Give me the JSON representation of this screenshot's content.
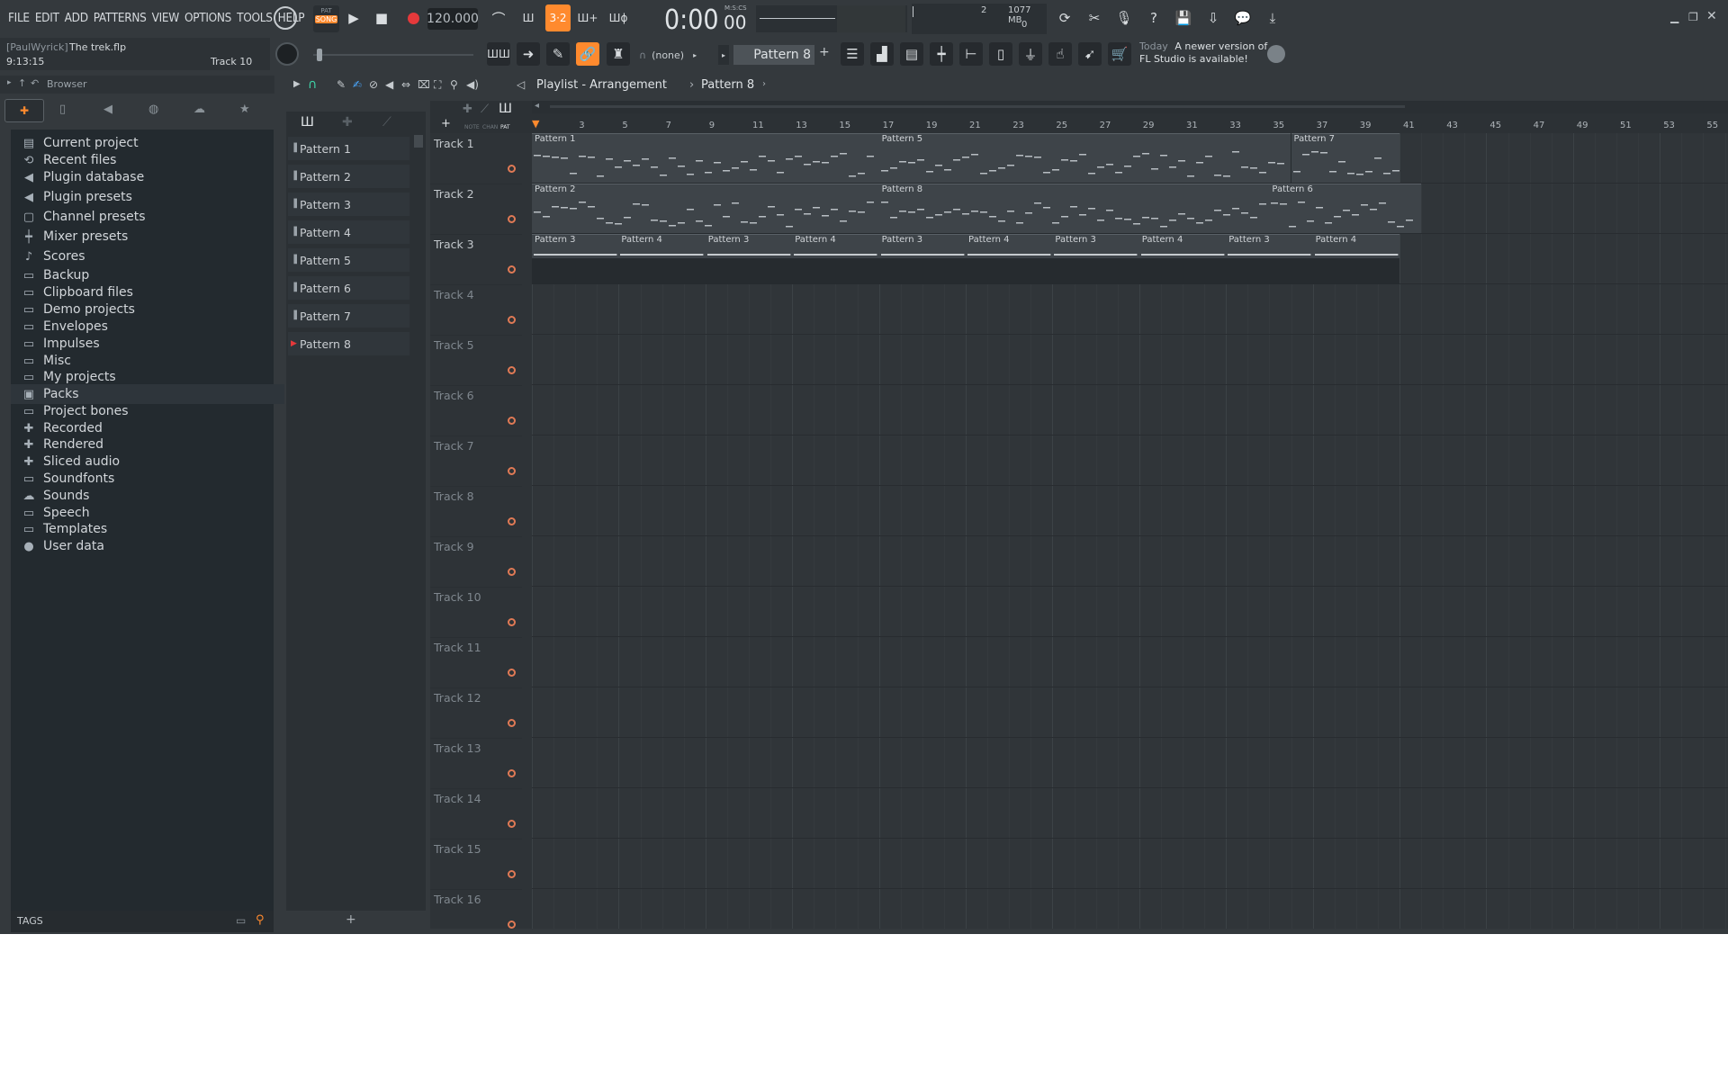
{
  "menu": [
    "FILE",
    "EDIT",
    "ADD",
    "PATTERNS",
    "VIEW",
    "OPTIONS",
    "TOOLS",
    "HELP"
  ],
  "transport": {
    "mode_top": "PAT",
    "mode_bottom": "SONG",
    "tempo": "120.000",
    "time_main": "0:00",
    "time_small": "00",
    "time_unit": "M:S:CS"
  },
  "monitor": {
    "value1": "2",
    "memory": "1077 MB",
    "value2": "0"
  },
  "project": {
    "user": "[PaulWyrick]",
    "file": "The trek.flp",
    "time": "9:13:15",
    "track": "Track 10"
  },
  "browser": {
    "title": "Browser",
    "items": [
      {
        "label": "Current project",
        "icon": "project-icon"
      },
      {
        "label": "Recent files",
        "icon": "recent-icon"
      },
      {
        "label": "Plugin database",
        "icon": "plugin-icon"
      },
      {
        "label": "Plugin presets",
        "icon": "plugin-icon"
      },
      {
        "label": "Channel presets",
        "icon": "channel-icon"
      },
      {
        "label": "Mixer presets",
        "icon": "mixer-icon"
      },
      {
        "label": "Scores",
        "icon": "note-icon"
      },
      {
        "label": "Backup",
        "icon": "folder-icon"
      },
      {
        "label": "Clipboard files",
        "icon": "folder-icon"
      },
      {
        "label": "Demo projects",
        "icon": "folder-icon"
      },
      {
        "label": "Envelopes",
        "icon": "folder-icon"
      },
      {
        "label": "Impulses",
        "icon": "folder-icon"
      },
      {
        "label": "Misc",
        "icon": "folder-icon"
      },
      {
        "label": "My projects",
        "icon": "folder-icon"
      },
      {
        "label": "Packs",
        "icon": "packs-icon"
      },
      {
        "label": "Project bones",
        "icon": "folder-icon"
      },
      {
        "label": "Recorded",
        "icon": "recorded-icon"
      },
      {
        "label": "Rendered",
        "icon": "rendered-icon"
      },
      {
        "label": "Sliced audio",
        "icon": "sliced-icon"
      },
      {
        "label": "Soundfonts",
        "icon": "folder-icon"
      },
      {
        "label": "Sounds",
        "icon": "cloud-icon"
      },
      {
        "label": "Speech",
        "icon": "folder-icon"
      },
      {
        "label": "Templates",
        "icon": "folder-icon"
      },
      {
        "label": "User data",
        "icon": "user-icon"
      }
    ],
    "tags_label": "TAGS"
  },
  "pattern_selector": {
    "value": "Pattern 8",
    "none_label": "(none)"
  },
  "hint": {
    "line1": "Today",
    "line2": "A newer version of",
    "line3": "FL Studio is available!"
  },
  "playlist": {
    "title": "Playlist - Arrangement",
    "crumb": "Pattern 8",
    "picker_tabs": [
      "NOTE",
      "CHAN",
      "PAT"
    ],
    "patterns": [
      "Pattern 1",
      "Pattern 2",
      "Pattern 3",
      "Pattern 4",
      "Pattern 5",
      "Pattern 6",
      "Pattern 7",
      "Pattern 8"
    ],
    "tracks": [
      "Track 1",
      "Track 2",
      "Track 3",
      "Track 4",
      "Track 5",
      "Track 6",
      "Track 7",
      "Track 8",
      "Track 9",
      "Track 10",
      "Track 11",
      "Track 12",
      "Track 13",
      "Track 14",
      "Track 15",
      "Track 16"
    ],
    "bar_labels": [
      "3",
      "5",
      "7",
      "9",
      "11",
      "13",
      "15",
      "17",
      "19",
      "21",
      "23",
      "25",
      "27",
      "29",
      "31",
      "33",
      "35",
      "37",
      "39",
      "41",
      "43",
      "45",
      "47",
      "49",
      "51",
      "53",
      "55"
    ],
    "clips": [
      {
        "track": 0,
        "label": "Pattern 1",
        "start": 1,
        "end": 17
      },
      {
        "track": 0,
        "label": "Pattern 5",
        "start": 17,
        "end": 36
      },
      {
        "track": 0,
        "label": "Pattern 7",
        "start": 36,
        "end": 41
      },
      {
        "track": 1,
        "label": "Pattern 2",
        "start": 1,
        "end": 17
      },
      {
        "track": 1,
        "label": "Pattern 8",
        "start": 17,
        "end": 35
      },
      {
        "track": 1,
        "label": "Pattern 6",
        "start": 35,
        "end": 42
      },
      {
        "track": 2,
        "label": "Pattern 3",
        "start": 1,
        "end": 5
      },
      {
        "track": 2,
        "label": "Pattern 4",
        "start": 5,
        "end": 9
      },
      {
        "track": 2,
        "label": "Pattern 3",
        "start": 9,
        "end": 13
      },
      {
        "track": 2,
        "label": "Pattern 4",
        "start": 13,
        "end": 17
      },
      {
        "track": 2,
        "label": "Pattern 3",
        "start": 17,
        "end": 21
      },
      {
        "track": 2,
        "label": "Pattern 4",
        "start": 21,
        "end": 25
      },
      {
        "track": 2,
        "label": "Pattern 3",
        "start": 25,
        "end": 29
      },
      {
        "track": 2,
        "label": "Pattern 4",
        "start": 29,
        "end": 33
      },
      {
        "track": 2,
        "label": "Pattern 3",
        "start": 33,
        "end": 37
      },
      {
        "track": 2,
        "label": "Pattern 4",
        "start": 37,
        "end": 41
      }
    ]
  },
  "colors": {
    "accent": "#ff8a2e",
    "record": "#e5393b",
    "led": "#e07a55",
    "background": "#34393d"
  }
}
